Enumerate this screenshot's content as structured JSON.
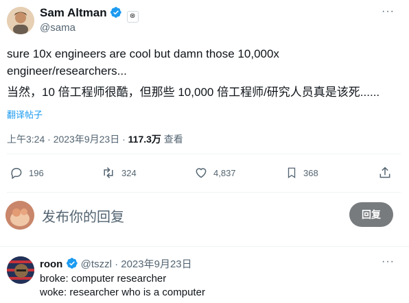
{
  "tweet": {
    "author_name": "Sam Altman",
    "author_handle": "@sama",
    "text_en_line1": "sure 10x engineers are cool but damn those 10,000x",
    "text_en_line2": "engineer/researchers...",
    "text_zh": "当然，10 倍工程师很酷，但那些 10,000 倍工程师/研究人员真是该死......",
    "translate_label": "翻译帖子",
    "time": "上午3:24 · 2023年9月23日 · ",
    "views_count": "117.3万",
    "views_label": " 查看",
    "actions": {
      "replies": "196",
      "retweets": "324",
      "likes": "4,837",
      "bookmarks": "368"
    }
  },
  "composer": {
    "placeholder": "发布你的回复",
    "reply_button": "回复"
  },
  "reply": {
    "author_name": "roon",
    "author_handle": "@tszzl",
    "date": "· 2023年9月23日",
    "line1": "broke: computer researcher",
    "line2": "woke: researcher who is a computer"
  },
  "colors": {
    "accent": "#1d9bf0",
    "muted": "#536471",
    "reply_button_bg": "#787b7e"
  },
  "icons": [
    "verified-badge-icon",
    "affiliate-badge-icon",
    "more-icon",
    "reply-icon",
    "retweet-icon",
    "like-icon",
    "bookmark-icon",
    "share-icon"
  ]
}
